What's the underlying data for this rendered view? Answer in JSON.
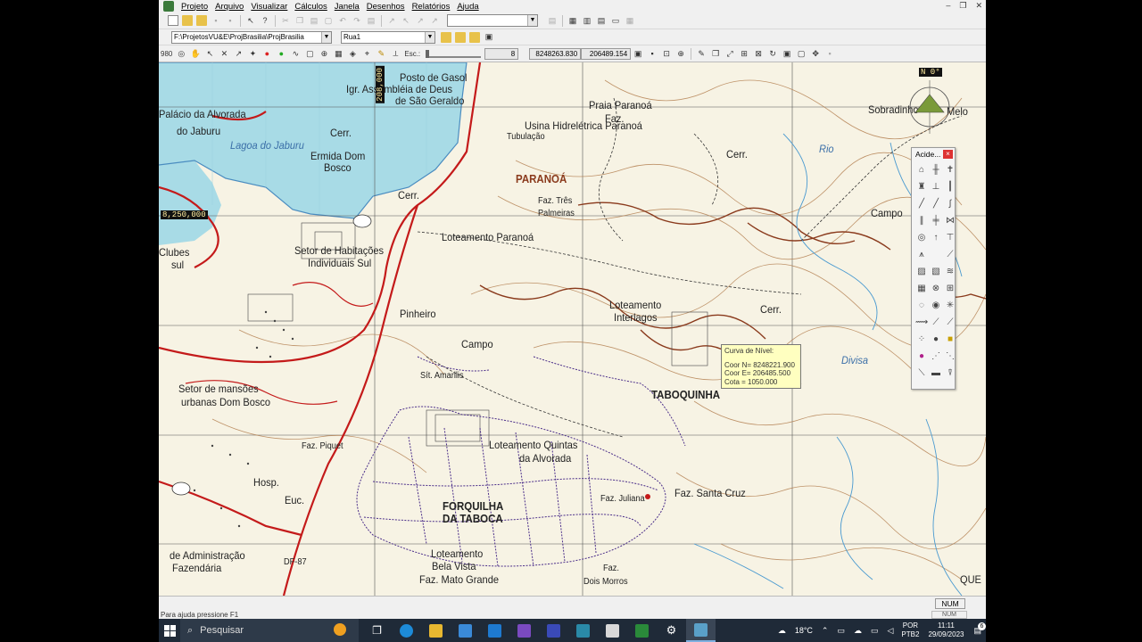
{
  "menubar": {
    "items": [
      "Projeto",
      "Arquivo",
      "Visualizar",
      "Cálculos",
      "Janela",
      "Desenhos",
      "Relatórios",
      "Ajuda"
    ]
  },
  "toolbar2": {
    "path": "F:\\ProjetosVU&E\\ProjBrasilia\\ProjBrasilia",
    "layer": "Rua1"
  },
  "toolbar3": {
    "scale_value": "980",
    "esc_label": "Esc.:",
    "zoom_value": "8",
    "coord_n": "8248263.830",
    "coord_e": "206489.154"
  },
  "map": {
    "coord_box_1": "8,250,000",
    "coord_box_2": "208,000",
    "compass": "N 0°",
    "labels": [
      {
        "text": "Posto de Gasol"
      },
      {
        "text": "Igr. Assembléia de Deus"
      },
      {
        "text": "de São Geraldo"
      },
      {
        "text": "Usina Hidrelétrica Paranoá"
      },
      {
        "text": "Tubulação"
      },
      {
        "text": "Faz."
      },
      {
        "text": "Praia Paranoá"
      },
      {
        "text": "Palácio da Alvorada"
      },
      {
        "text": "do Jaburu"
      },
      {
        "text": "Lagoa do Jaburu"
      },
      {
        "text": "Cerr."
      },
      {
        "text": "Ermida Dom"
      },
      {
        "text": "Bosco"
      },
      {
        "text": "PARANOÁ"
      },
      {
        "text": "Faz. Três"
      },
      {
        "text": "Palmeiras"
      },
      {
        "text": "Cerr."
      },
      {
        "text": "Cerr."
      },
      {
        "text": "Campo"
      },
      {
        "text": "Loteamento Paranoá"
      },
      {
        "text": "Setor de Habitações"
      },
      {
        "text": "Individuais Sul"
      },
      {
        "text": "Clubes"
      },
      {
        "text": "sul"
      },
      {
        "text": "Pinheiro"
      },
      {
        "text": "Loteamento"
      },
      {
        "text": "Interlagos"
      },
      {
        "text": "Cerr."
      },
      {
        "text": "Campo"
      },
      {
        "text": "Sobradinho"
      },
      {
        "text": "Melo"
      },
      {
        "text": "Rio"
      },
      {
        "text": "Sít. Amarilis"
      },
      {
        "text": "TABOQUINHA"
      },
      {
        "text": "Setor de mansões"
      },
      {
        "text": "urbanas Dom Bosco"
      },
      {
        "text": "Faz. Piquet"
      },
      {
        "text": "Loteamento Quintas"
      },
      {
        "text": "da Alvorada"
      },
      {
        "text": "Hosp."
      },
      {
        "text": "Euc."
      },
      {
        "text": "FORQUILHA"
      },
      {
        "text": "DA TABOCA"
      },
      {
        "text": "Faz. Juliana"
      },
      {
        "text": "Faz. Santa Cruz"
      },
      {
        "text": "de Administração"
      },
      {
        "text": "Fazendária"
      },
      {
        "text": "DF-87"
      },
      {
        "text": "Loteamento"
      },
      {
        "text": "Bela Vista"
      },
      {
        "text": "Faz. Mato Grande"
      },
      {
        "text": "Faz."
      },
      {
        "text": "Dois Morros"
      },
      {
        "text": "Divisa"
      },
      {
        "text": "QUE"
      }
    ]
  },
  "tooltip": {
    "title": "Curva de Nível:",
    "coor_n": "Coor N= 8248221.900",
    "coor_e": "Coor E= 206485.500",
    "cota": "Cota = 1050.000"
  },
  "palette": {
    "title": "Acide..."
  },
  "statusbar": {
    "help": "Para ajuda pressione F1",
    "num": "NUM",
    "num2": "NUM"
  },
  "taskbar": {
    "search_placeholder": "Pesquisar",
    "temperature": "18°C",
    "lang_1": "POR",
    "lang_2": "PTB2",
    "time": "11:11",
    "date": "29/09/2023",
    "notif_count": "6"
  }
}
